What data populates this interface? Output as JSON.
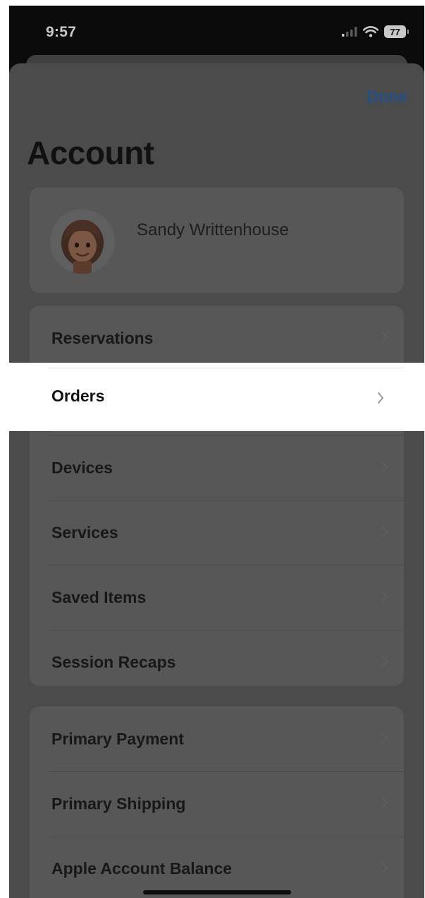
{
  "status_bar": {
    "time": "9:57",
    "battery": "77",
    "icons": [
      "cellular-signal-icon",
      "wifi-icon",
      "battery-icon"
    ]
  },
  "header": {
    "done_label": "Done",
    "title": "Account"
  },
  "profile": {
    "name": "Sandy Writtenhouse",
    "avatar_icon": "memoji-avatar"
  },
  "account_items": [
    {
      "label": "Reservations"
    },
    {
      "label": "Orders",
      "highlighted": true
    },
    {
      "label": "Devices"
    },
    {
      "label": "Services"
    },
    {
      "label": "Saved Items"
    },
    {
      "label": "Session Recaps"
    }
  ],
  "payment_items": [
    {
      "label": "Primary Payment"
    },
    {
      "label": "Primary Shipping"
    },
    {
      "label": "Apple Account Balance"
    }
  ],
  "colors": {
    "accent": "#24508a",
    "dimmed_background": "#4b4b4b",
    "highlight": "#ffffff"
  }
}
